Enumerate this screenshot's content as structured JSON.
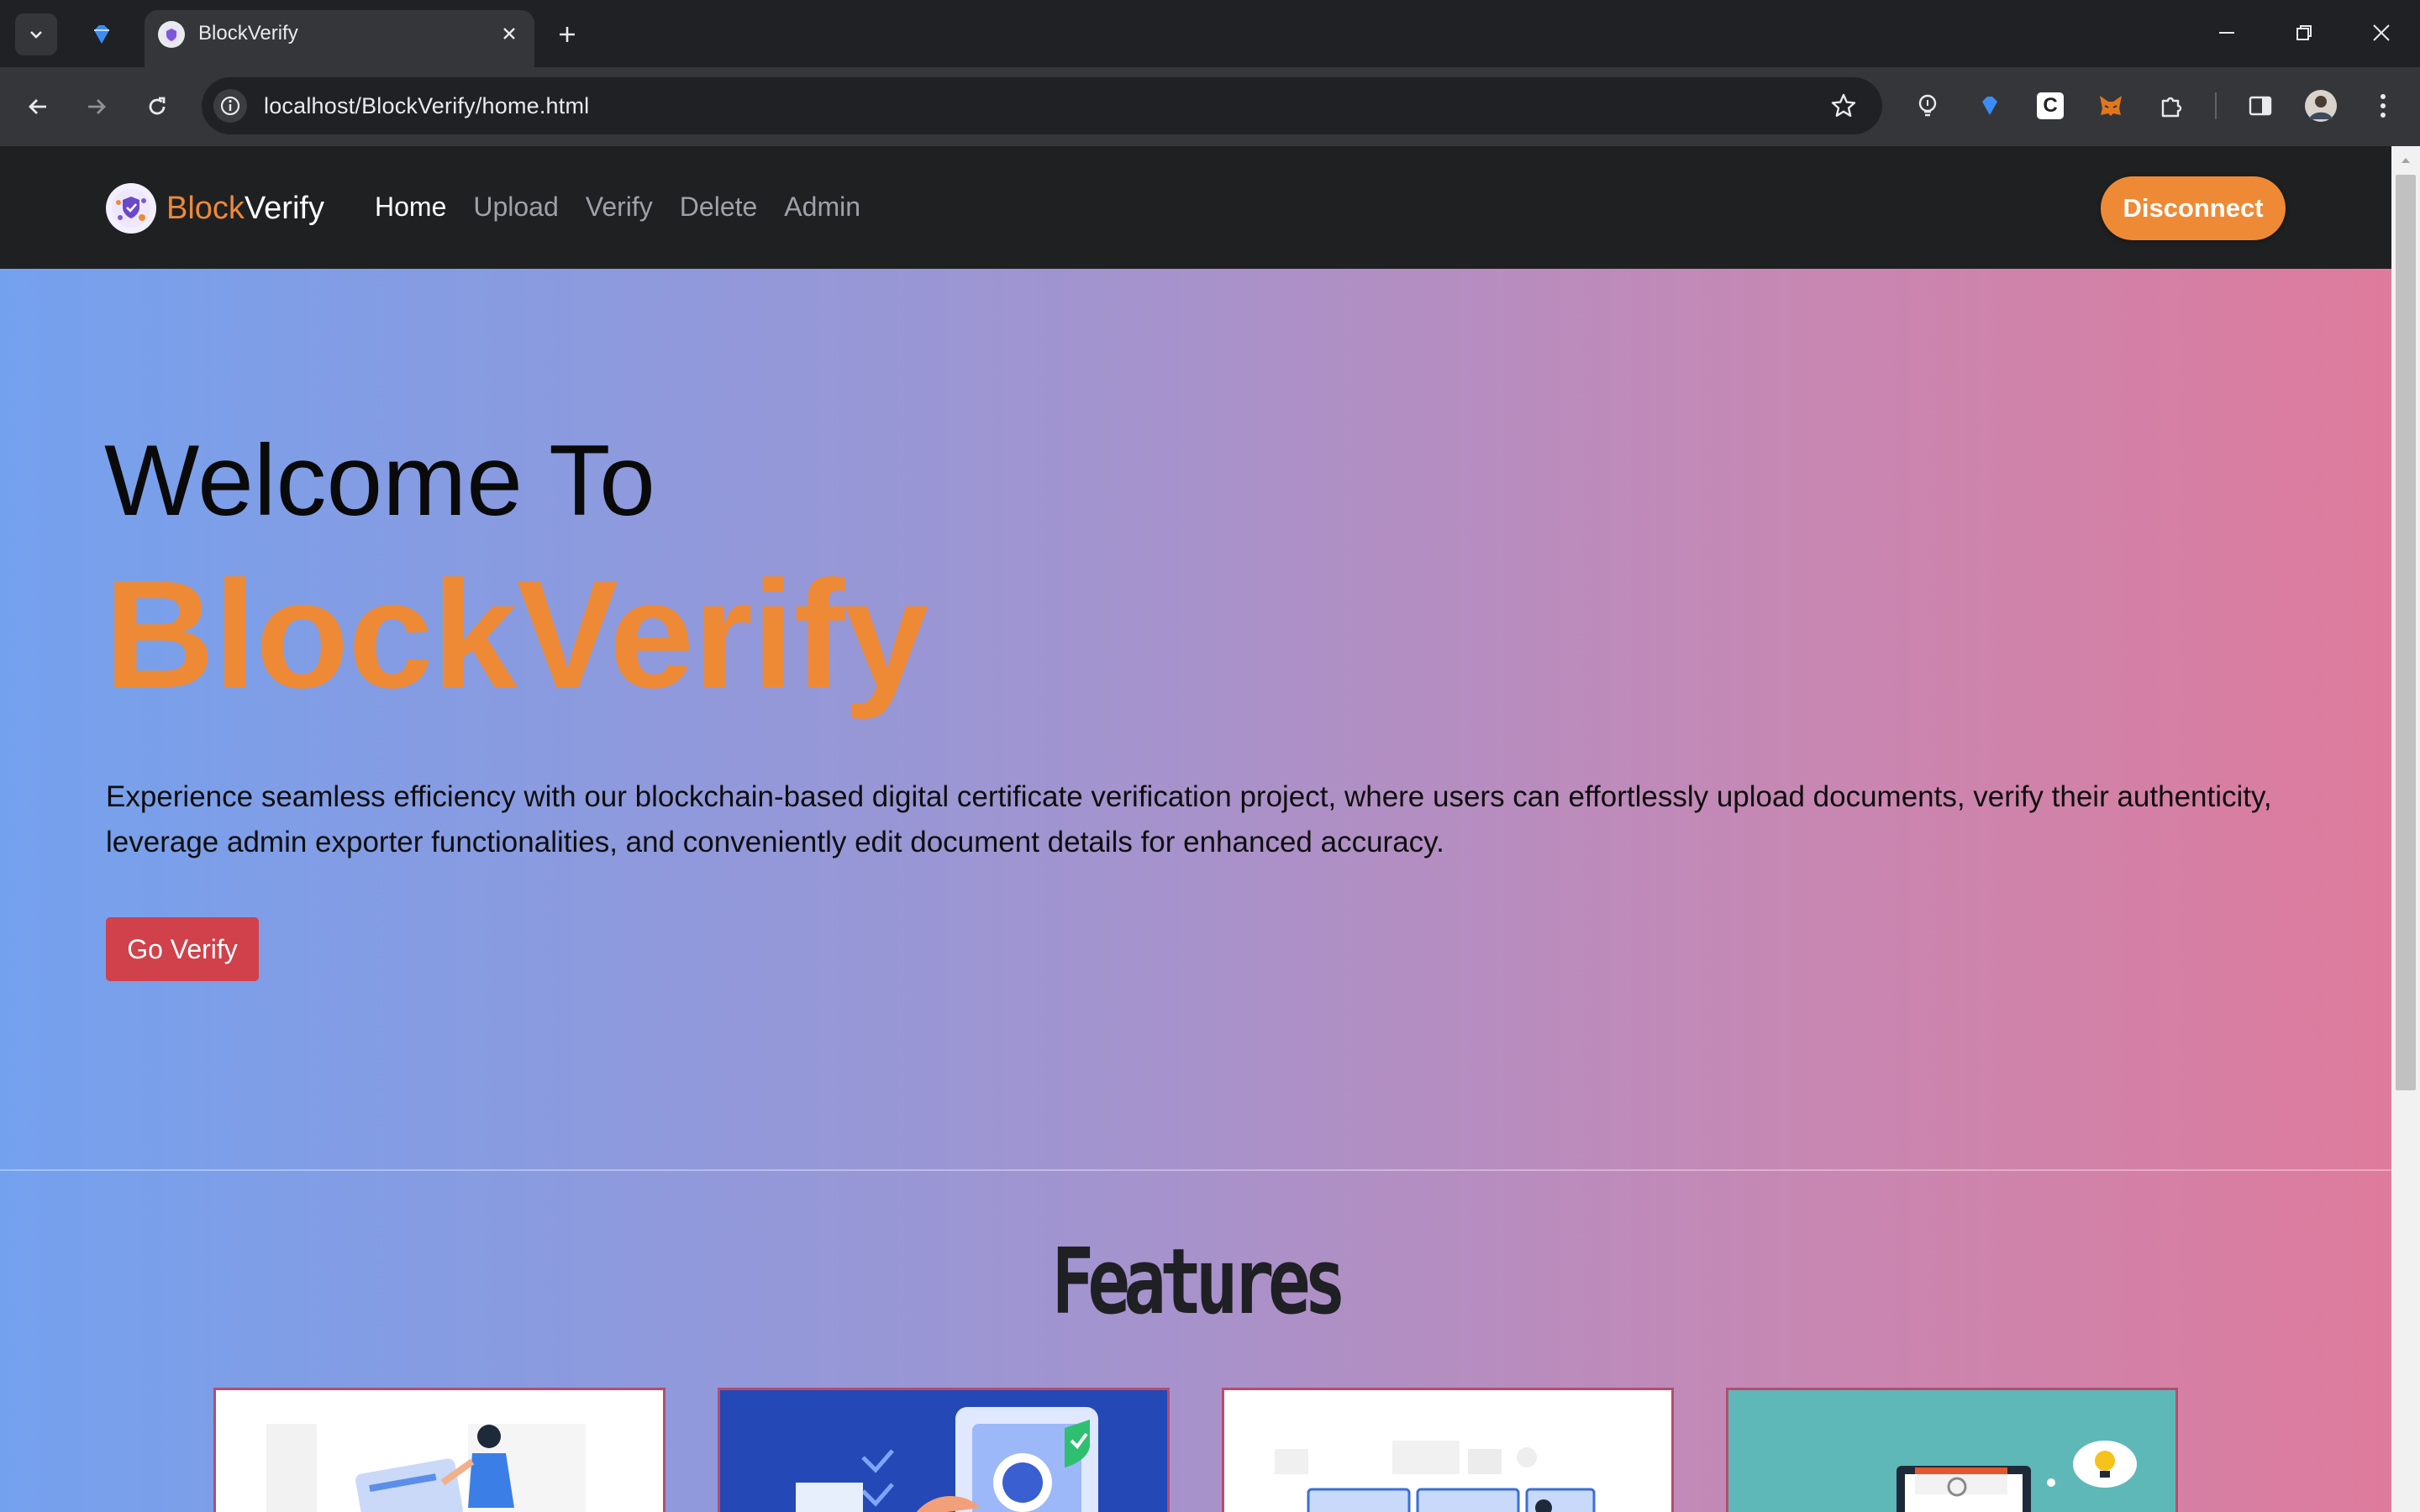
{
  "browser": {
    "tab_title": "BlockVerify",
    "url": "localhost/BlockVerify/home.html",
    "extension_letter": "C"
  },
  "site": {
    "brand_block": "Block",
    "brand_verify": "Verify",
    "nav": [
      {
        "label": "Home",
        "active": true
      },
      {
        "label": "Upload",
        "active": false
      },
      {
        "label": "Verify",
        "active": false
      },
      {
        "label": "Delete",
        "active": false
      },
      {
        "label": "Admin",
        "active": false
      }
    ],
    "disconnect_label": "Disconnect"
  },
  "hero": {
    "welcome": "Welcome To",
    "title": "BlockVerify",
    "description": "Experience seamless efficiency with our blockchain-based digital certificate verification project, where users can effortlessly upload documents, verify their authenticity, leverage admin exporter functionalities, and conveniently edit document details for enhanced accuracy.",
    "cta_label": "Go Verify"
  },
  "features": {
    "title": "Features"
  },
  "colors": {
    "accent_orange": "#ee8a36",
    "cta_red": "#d0414b",
    "navbar": "#1f2022"
  }
}
